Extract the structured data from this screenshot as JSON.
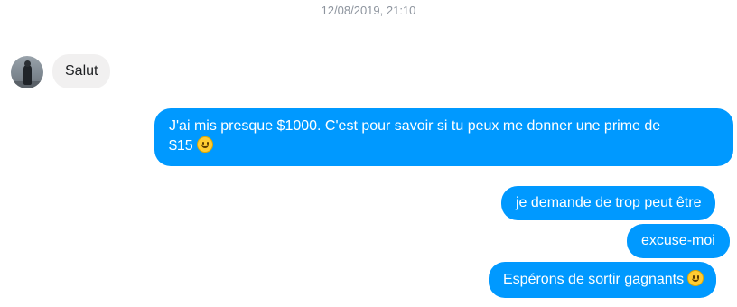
{
  "conversation": {
    "timestamp": "12/08/2019, 21:10",
    "messages": [
      {
        "sender": "other",
        "text": "Salut"
      },
      {
        "sender": "me",
        "line1": "J'ai mis presque $1000. C'est pour savoir si tu peux me donner une prime de",
        "line2": "$15",
        "emoji": "slightly-smiling-face"
      },
      {
        "sender": "me",
        "text": "je demande de trop peut être"
      },
      {
        "sender": "me",
        "text": "excuse-moi"
      },
      {
        "sender": "me",
        "text": "Espérons de sortir gagnants",
        "emoji": "slightly-smiling-face"
      }
    ]
  },
  "colors": {
    "outgoing_bubble": "#0099ff",
    "incoming_bubble": "#f1f0f0",
    "timestamp_text": "#8d949e"
  }
}
